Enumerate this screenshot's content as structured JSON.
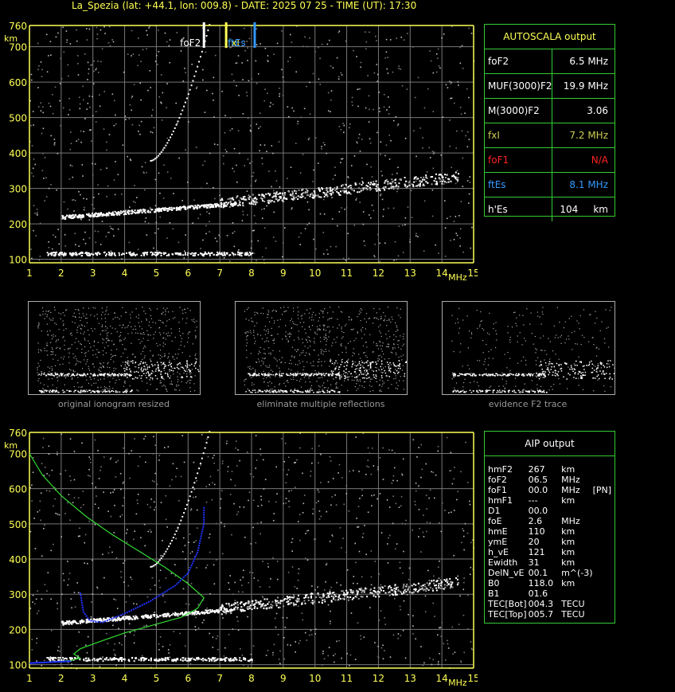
{
  "header": {
    "title": "La_Spezia (lat: +44.1, lon: 009.8) - DATE: 2025 07 25 - TIME (UT): 17:30"
  },
  "colors": {
    "axis": "#ffff55",
    "grid": "#777777",
    "panel_border": "#33cc33",
    "foF2_marker": "#ffffff",
    "fxI_marker": "#ffff55",
    "ftEs_marker": "#3399ff",
    "profile_curve": "#33dd33",
    "trace_fit": "#2233ff",
    "foF1_value": "#ff2222",
    "ftEs_value": "#3399ff",
    "fxI_value": "#cccc55"
  },
  "ionogram": {
    "x_ticks": [
      "1",
      "2",
      "3",
      "4",
      "5",
      "6",
      "7",
      "8",
      "9",
      "10",
      "11",
      "12",
      "13",
      "14",
      "15"
    ],
    "x_unit": "MHz",
    "y_ticks": [
      "100",
      "200",
      "300",
      "400",
      "500",
      "600",
      "700",
      "760"
    ],
    "y_unit": "km",
    "x_range": [
      1,
      15
    ],
    "y_range": [
      90,
      760
    ],
    "grid": true,
    "markers": [
      {
        "label": "foF2",
        "freq": 6.5,
        "color_key": "foF2_marker"
      },
      {
        "label": "fxI",
        "freq": 7.2,
        "color_key": "fxI_marker"
      },
      {
        "label": "ftEs",
        "freq": 8.1,
        "color_key": "ftEs_marker"
      }
    ]
  },
  "autoscala": {
    "header": "AUTOSCALA output",
    "rows": [
      {
        "label": "foF2",
        "value": "6.5 MHz",
        "color": "#ffffff"
      },
      {
        "label": "MUF(3000)F2",
        "value": "19.9 MHz",
        "color": "#ffffff"
      },
      {
        "label": "M(3000)F2",
        "value": "3.06",
        "color": "#ffffff"
      },
      {
        "label": "fxI",
        "value": "7.2 MHz",
        "color": "#cccc55"
      },
      {
        "label": "foF1",
        "value": "N/A",
        "color": "#ff2222"
      },
      {
        "label": "ftEs",
        "value": "8.1 MHz",
        "color": "#3399ff"
      },
      {
        "label": "h'Es",
        "value": "104     km",
        "color": "#ffffff"
      }
    ]
  },
  "thumbnails": [
    {
      "caption": "original ionogram resized"
    },
    {
      "caption": "eliminate multiple reflections"
    },
    {
      "caption": "evidence F2 trace"
    }
  ],
  "aip": {
    "header": "AIP output",
    "rows": [
      [
        "hmF2",
        "267",
        "km",
        ""
      ],
      [
        "foF2",
        "06.5",
        "MHz",
        ""
      ],
      [
        "foF1",
        "00.0",
        "MHz",
        "[PN]"
      ],
      [
        "hmF1",
        "---",
        "km",
        ""
      ],
      [
        "D1",
        "00.0",
        "",
        ""
      ],
      [
        "foE",
        "2.6",
        "MHz",
        ""
      ],
      [
        "hmE",
        "110",
        "km",
        ""
      ],
      [
        "ymE",
        "20",
        "km",
        ""
      ],
      [
        "h_vE",
        "121",
        "km",
        ""
      ],
      [
        "Ewidth",
        "31",
        "km",
        ""
      ],
      [
        "DelN_vE",
        "00.1",
        "m^(-3)",
        ""
      ],
      [
        "B0",
        "118.0",
        "km",
        ""
      ],
      [
        "B1",
        "01.6",
        "",
        ""
      ],
      [
        "TEC[Bot]",
        "004.3",
        "TECU",
        ""
      ],
      [
        "TEC[Top]",
        "005.7",
        "TECU",
        ""
      ]
    ]
  }
}
